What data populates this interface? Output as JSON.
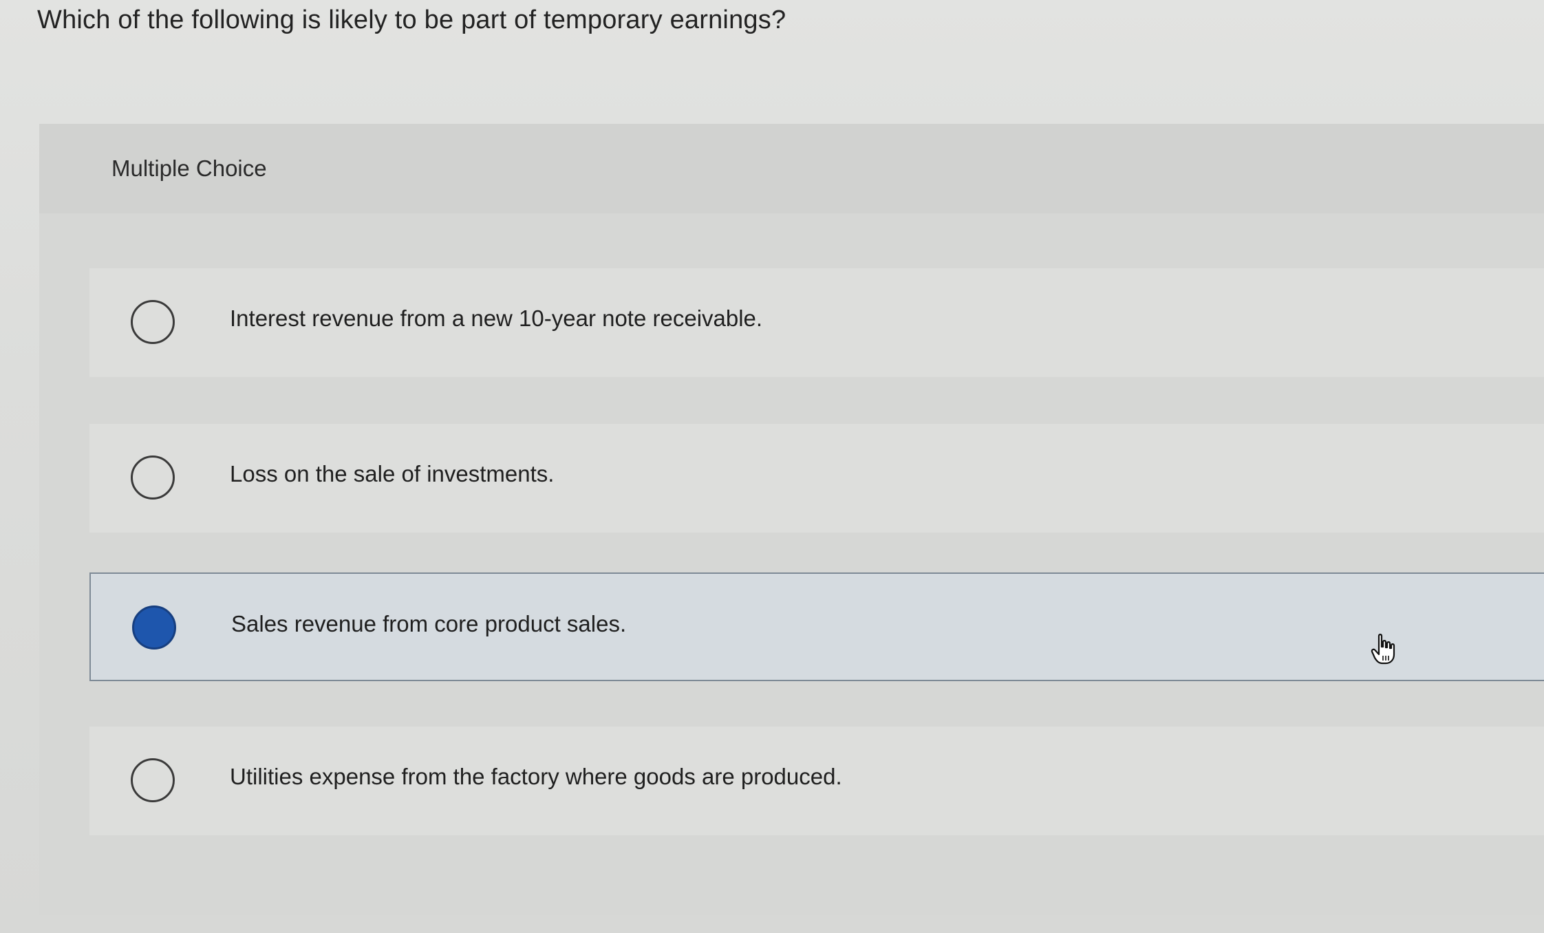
{
  "question": {
    "text": "Which of the following is likely to be part of temporary earnings?"
  },
  "panel": {
    "label": "Multiple Choice"
  },
  "choices": [
    {
      "text": "Interest revenue from a new 10-year note receivable.",
      "selected": false
    },
    {
      "text": "Loss on the sale of investments.",
      "selected": false
    },
    {
      "text": "Sales revenue from core product sales.",
      "selected": true
    },
    {
      "text": "Utilities expense from the factory where goods are produced.",
      "selected": false
    }
  ],
  "colors": {
    "selected_radio": "#1e56ad",
    "selected_background": "#d5dbe0",
    "selected_border": "#7e8a96"
  },
  "icons": {
    "cursor": "hand-pointer-icon"
  }
}
